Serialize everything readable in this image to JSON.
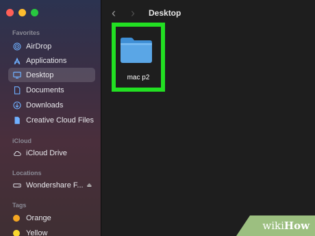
{
  "window": {
    "title": "Desktop"
  },
  "sidebar": {
    "sections": {
      "favorites": "Favorites",
      "icloud": "iCloud",
      "locations": "Locations",
      "tags": "Tags"
    },
    "favorites": [
      {
        "label": "AirDrop",
        "icon": "airdrop-icon"
      },
      {
        "label": "Applications",
        "icon": "applications-icon"
      },
      {
        "label": "Desktop",
        "icon": "desktop-icon",
        "selected": true
      },
      {
        "label": "Documents",
        "icon": "document-icon"
      },
      {
        "label": "Downloads",
        "icon": "downloads-icon"
      },
      {
        "label": "Creative Cloud Files",
        "icon": "file-icon"
      }
    ],
    "icloud": [
      {
        "label": "iCloud Drive",
        "icon": "cloud-icon"
      }
    ],
    "locations": [
      {
        "label": "Wondershare F...",
        "icon": "drive-icon"
      }
    ],
    "tags": [
      {
        "label": "Orange",
        "color": "#f5a623"
      },
      {
        "label": "Yellow",
        "color": "#f8d92f"
      }
    ]
  },
  "content": {
    "items": [
      {
        "label": "mac p2",
        "icon": "folder-icon"
      }
    ]
  },
  "colors": {
    "highlight": "#22e022",
    "folder": "#5aa6e6"
  },
  "watermark": {
    "prefix": "wiki",
    "suffix": "How"
  }
}
